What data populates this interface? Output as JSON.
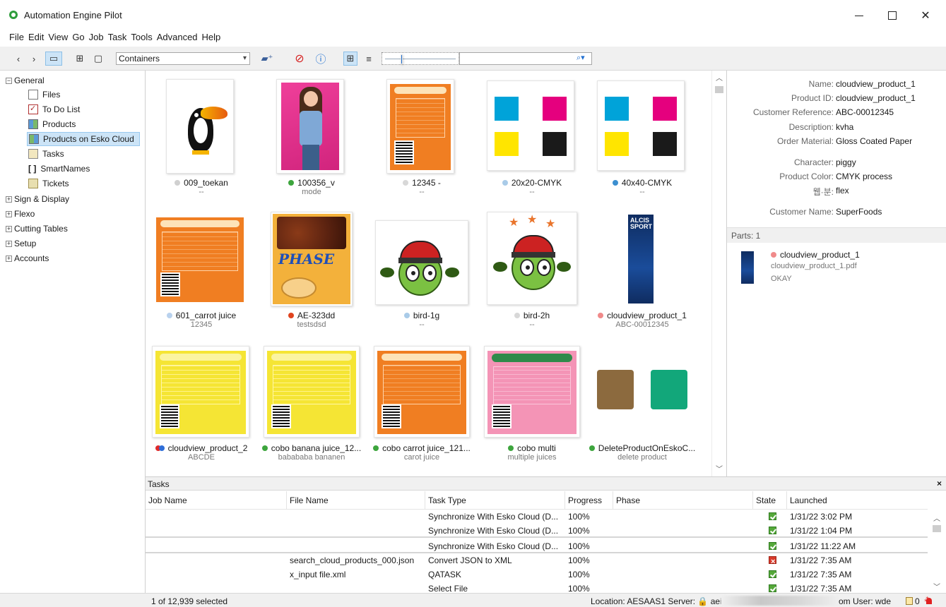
{
  "window": {
    "title": "Automation Engine Pilot"
  },
  "menu": [
    "File",
    "Edit",
    "View",
    "Go",
    "Job",
    "Task",
    "Tools",
    "Advanced",
    "Help"
  ],
  "toolbar": {
    "container_select": "Containers",
    "search_value": ""
  },
  "tree": {
    "general": "General",
    "general_children": [
      "Files",
      "To Do List",
      "Products",
      "Products on Esko Cloud",
      "Tasks",
      "SmartNames",
      "Tickets"
    ],
    "selected": "Products on Esko Cloud",
    "groups": [
      "Sign & Display",
      "Flexo",
      "Cutting Tables",
      "Setup",
      "Accounts"
    ]
  },
  "products": [
    {
      "name": "009_toekan",
      "sub": "--",
      "dot": "#d0d0d0"
    },
    {
      "name": "100356_v",
      "sub": "mode",
      "dot": "#3da53d"
    },
    {
      "name": "12345 -",
      "sub": "--",
      "dot": "#d8d8d8"
    },
    {
      "name": "20x20-CMYK",
      "sub": "--",
      "dot": "#a9cbe8"
    },
    {
      "name": "40x40-CMYK",
      "sub": "--",
      "dot": "#3c8fd0"
    },
    {
      "name": "601_carrot juice",
      "sub": "12345",
      "dot": "#b9d2ee"
    },
    {
      "name": "AE-323dd",
      "sub": "testsdsd",
      "dot": "#e0441f"
    },
    {
      "name": "bird-1g",
      "sub": "--",
      "dot": "#a9cbe8"
    },
    {
      "name": "bird-2h",
      "sub": "--",
      "dot": "#d8d8d8"
    },
    {
      "name": "cloudview_product_1",
      "sub": "ABC-00012345",
      "dot": "#f08a8a"
    },
    {
      "name": "cloudview_product_2",
      "sub": "ABCDE",
      "dot": "#e02a2a"
    },
    {
      "name": "cobo banana juice_12...",
      "sub": "babababa bananen",
      "dot": "#3da53d"
    },
    {
      "name": "cobo carrot juice_121...",
      "sub": "carot juice",
      "dot": "#3da53d"
    },
    {
      "name": "cobo multi",
      "sub": "multiple juices",
      "dot": "#3da53d"
    },
    {
      "name": "DeleteProductOnEskoC...",
      "sub": "delete product",
      "dot": "#3da53d"
    }
  ],
  "properties": {
    "rows": [
      {
        "label": "Name:",
        "value": "cloudview_product_1"
      },
      {
        "label": "Product ID:",
        "value": "cloudview_product_1"
      },
      {
        "label": "Customer Reference:",
        "value": "ABC-00012345"
      },
      {
        "label": "Description:",
        "value": "kvha"
      },
      {
        "label": "Order Material:",
        "value": "Gloss Coated Paper"
      },
      {
        "label": "Character:",
        "value": "piggy"
      },
      {
        "label": "Product Color:",
        "value": "CMYK process"
      },
      {
        "label": "웹·분:",
        "value": "flex"
      },
      {
        "label": "Customer Name:",
        "value": "SuperFoods"
      }
    ],
    "parts_header": "Parts: 1",
    "part": {
      "name": "cloudview_product_1",
      "file": "cloudview_product_1.pdf",
      "status": "OKAY",
      "dot": "#f08a8a"
    }
  },
  "tasks": {
    "title": "Tasks",
    "close": "×",
    "columns": [
      "Job Name",
      "File Name",
      "Task Type",
      "Progress",
      "Phase",
      "State",
      "Launched"
    ],
    "rows": [
      {
        "job": "",
        "file": "",
        "type": "Synchronize With Esko Cloud (D...",
        "progress": "100%",
        "phase": "",
        "state": "ok",
        "launched": "1/31/22 3:02 PM"
      },
      {
        "job": "",
        "file": "",
        "type": "Synchronize With Esko Cloud (D...",
        "progress": "100%",
        "phase": "",
        "state": "ok",
        "launched": "1/31/22 1:04 PM"
      },
      {
        "job": "",
        "file": "",
        "type": "Synchronize With Esko Cloud (D...",
        "progress": "100%",
        "phase": "",
        "state": "ok",
        "launched": "1/31/22 11:22 AM"
      },
      {
        "job": "",
        "file": "search_cloud_products_000.json",
        "type": "Convert JSON to XML",
        "progress": "100%",
        "phase": "",
        "state": "error",
        "launched": "1/31/22 7:35 AM"
      },
      {
        "job": "",
        "file": "x_input file.xml",
        "type": "QATASK",
        "progress": "100%",
        "phase": "",
        "state": "ok",
        "launched": "1/31/22 7:35 AM"
      },
      {
        "job": "",
        "file": "",
        "type": "Select File",
        "progress": "100%",
        "phase": "",
        "state": "ok",
        "launched": "1/31/22 7:35 AM"
      }
    ]
  },
  "status": {
    "selection": "1 of 12,939 selected",
    "location": "Location: AESAAS1   Server: 🔒 aei",
    "user": "om   User: wde",
    "alerts": "0"
  }
}
